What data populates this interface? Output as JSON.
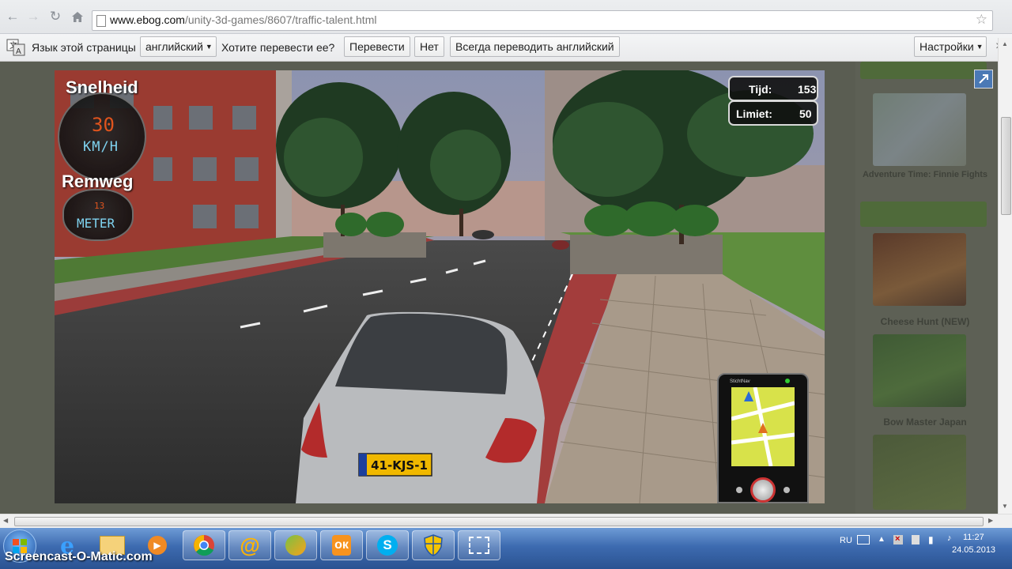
{
  "browser": {
    "url_host": "www.ebog.com",
    "url_path": "/unity-3d-games/8607/traffic-talent.html"
  },
  "translate_bar": {
    "page_language_label": "Язык этой страницы",
    "language_value": "английский",
    "question": "Хотите перевести ее?",
    "translate_button": "Перевести",
    "no_button": "Нет",
    "always_translate_button": "Всегда переводить английский",
    "settings_button": "Настройки"
  },
  "game": {
    "speed_label": "Snelheid",
    "speed_value": "30",
    "speed_unit": "KM/H",
    "brake_label": "Remweg",
    "brake_value": "13",
    "brake_unit": "METER",
    "time_label": "Tijd:",
    "time_value": "153",
    "limit_label": "Limiet:",
    "limit_value": "50",
    "license_plate": "41-KJS-1",
    "navigator_brand": "StichtNav"
  },
  "sidebar": {
    "games": [
      {
        "caption": "Adventure Time: Finnie Fights"
      },
      {
        "caption": "Cheese Hunt (NEW)"
      },
      {
        "caption": "Bow Master Japan"
      }
    ]
  },
  "taskbar": {
    "language": "RU",
    "time": "11:27",
    "date": "24.05.2013"
  },
  "watermark": "Screencast-O-Matic.com",
  "colors": {
    "taskbar": "#3d6bb0",
    "accent_red": "#b3413b",
    "hud_orange": "#e0541d",
    "hud_cyan": "#7fd3f0"
  }
}
